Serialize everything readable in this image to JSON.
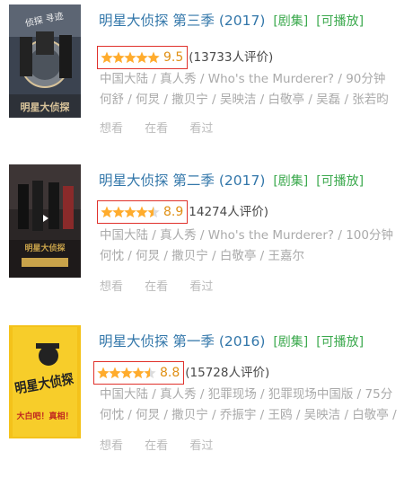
{
  "items": [
    {
      "title": "明星大侦探 第三季 (2017)",
      "tag_series": "[剧集]",
      "tag_play": "[可播放]",
      "score": "9.5",
      "stars": 5,
      "rating_count": "(13733人评价)",
      "meta_line1": "中国大陆 / 真人秀 / Who's the Murderer? / 90分钟",
      "meta_line2": "何舒 / 何炅 / 撒贝宁 / 吴映洁 / 白敬亭 / 吴磊 / 张若昀",
      "actions": [
        "想看",
        "在看",
        "看过"
      ],
      "poster_colors": {
        "bg": "#3b4350",
        "accent": "#d8c39a"
      },
      "poster_text": "明星大侦探"
    },
    {
      "title": "明星大侦探 第二季 (2017)",
      "tag_series": "[剧集]",
      "tag_play": "[可播放]",
      "score": "8.9",
      "stars": 4.5,
      "rating_count": "14274人评价)",
      "meta_line1": "中国大陆 / 真人秀 / Who's the Murderer? / 100分钟",
      "meta_line2": "何忱 / 何炅 / 撒贝宁 / 白敬亭 / 王嘉尔",
      "actions": [
        "想看",
        "在看",
        "看过"
      ],
      "poster_colors": {
        "bg": "#2b2626",
        "accent": "#c9a34a"
      },
      "poster_text": "明星大侦探"
    },
    {
      "title": "明星大侦探 第一季 (2016)",
      "tag_series": "[剧集]",
      "tag_play": "[可播放]",
      "score": "8.8",
      "stars": 4.5,
      "rating_count": "(15728人评价)",
      "meta_line1": "中国大陆 / 真人秀 / 犯罪现场 / 犯罪现场中国版 / 75分",
      "meta_line2": "何忱 / 何炅 / 撒贝宁 / 乔振宇 / 王鸥 / 吴映洁 / 白敬亭 /",
      "actions": [
        "想看",
        "在看",
        "看过"
      ],
      "poster_colors": {
        "bg": "#f4c21a",
        "accent": "#222222"
      },
      "poster_text": "明星大侦探",
      "poster_subtext": "大白吧！真相！"
    }
  ],
  "colors": {
    "title": "#3377aa",
    "tag": "#3ba94d",
    "score": "#e09015",
    "star": "#ffac2d",
    "highlight_box": "#e0312b"
  }
}
